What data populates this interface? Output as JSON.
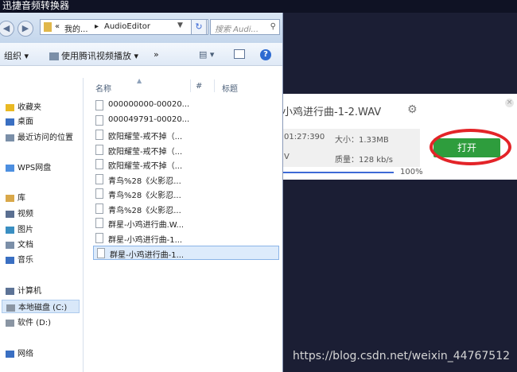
{
  "app": {
    "title": "迅捷音频转换器"
  },
  "converter": {
    "filename": "小鸡进行曲-1-2.WAV",
    "duration": "01:27:390",
    "size": "大小：1.33MB",
    "format": "V",
    "quality": "质量：128 kb/s",
    "progress": 1.0,
    "progress_label": "100%",
    "open_label": "打开",
    "close_glyph": "×",
    "gear_glyph": "⚙"
  },
  "watermark": "https://blog.csdn.net/weixin_44767512",
  "explorer": {
    "back_glyph": "◀",
    "forward_glyph": "▶",
    "address": {
      "overflow": "«",
      "crumb1": "我的...",
      "sep": "▸",
      "crumb2": "AudioEditor",
      "dropdown": "▼"
    },
    "refresh_glyph": "↻",
    "search_placeholder": "搜索 Audi...",
    "search_glyph": "⚲",
    "toolbar": {
      "organize": "组织 ▾",
      "play_with": "使用腾讯视频播放 ▾",
      "more": "»",
      "views": "▤ ▾",
      "help": "?"
    },
    "nav": [
      {
        "label": "收藏夹",
        "color": "#e9b923",
        "glyph": "★"
      },
      {
        "label": "桌面",
        "color": "#3a6fc2",
        "glyph": ""
      },
      {
        "label": "最近访问的位置",
        "color": "#7b8fa8",
        "glyph": ""
      },
      {
        "label": "WPS网盘",
        "color": "#4d8fe0",
        "glyph": "☁"
      },
      {
        "label": "库",
        "color": "#d9a84a",
        "glyph": ""
      },
      {
        "label": "视频",
        "color": "#5a6f91",
        "glyph": ""
      },
      {
        "label": "图片",
        "color": "#3a8fc2",
        "glyph": ""
      },
      {
        "label": "文档",
        "color": "#7b8fa8",
        "glyph": ""
      },
      {
        "label": "音乐",
        "color": "#3a6fc2",
        "glyph": "♪"
      },
      {
        "label": "计算机",
        "color": "#5d7396",
        "glyph": ""
      },
      {
        "label": "本地磁盘 (C:)",
        "color": "#8a95a3",
        "glyph": ""
      },
      {
        "label": "软件 (D:)",
        "color": "#8a95a3",
        "glyph": ""
      },
      {
        "label": "网络",
        "color": "#3a6fc2",
        "glyph": ""
      }
    ],
    "columns": {
      "name": "名称",
      "num": "#",
      "title": "标题",
      "sort": "▲"
    },
    "files": [
      "000000000-00020...",
      "000049791-00020...",
      "欧阳耀莹-戒不掉（...",
      "欧阳耀莹-戒不掉（...",
      "欧阳耀莹-戒不掉（...",
      "青鸟%28《火影忍...",
      "青鸟%28《火影忍...",
      "青鸟%28《火影忍...",
      "群星-小鸡进行曲.W...",
      "群星-小鸡进行曲-1...",
      "群星-小鸡进行曲-1..."
    ]
  }
}
